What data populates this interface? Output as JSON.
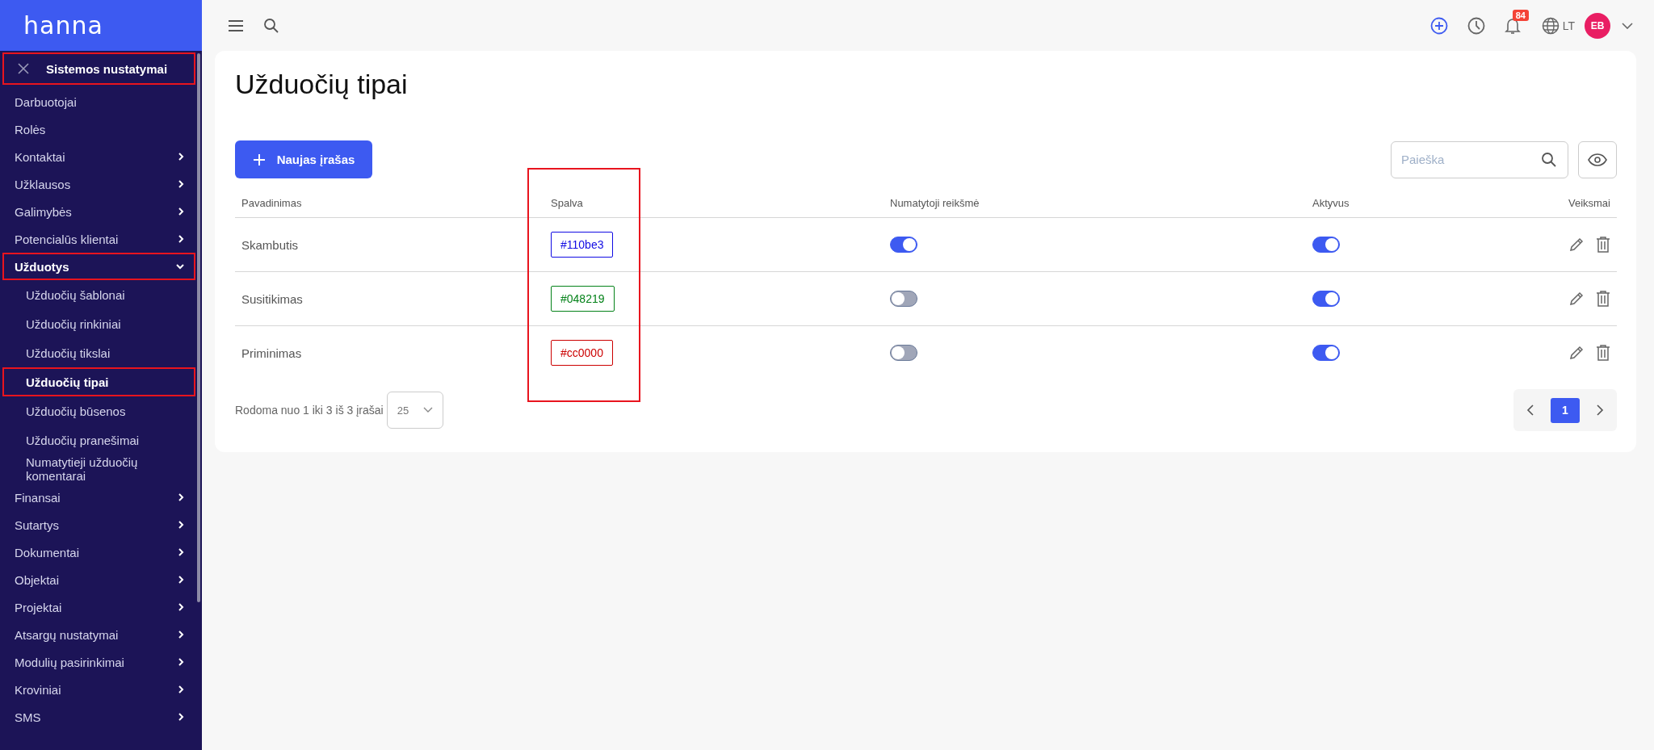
{
  "sidebar": {
    "logo": "hanna",
    "header": {
      "title": "Sistemos nustatymai",
      "highlighted": true
    },
    "items": [
      {
        "label": "Darbuotojai",
        "highlighted": false,
        "selected": false
      },
      {
        "label": "Rolės",
        "highlighted": false,
        "selected": false
      },
      {
        "label": "Kontaktai",
        "expanded": false,
        "highlighted": false,
        "selected": false
      },
      {
        "label": "Užklausos",
        "expanded": false,
        "highlighted": false,
        "selected": false
      },
      {
        "label": "Galimybės",
        "expanded": false,
        "highlighted": false,
        "selected": false
      },
      {
        "label": "Potencialūs klientai",
        "expanded": false,
        "highlighted": false,
        "selected": false
      },
      {
        "label": "Užduotys",
        "expanded": true,
        "highlighted": true,
        "selected": true,
        "children": [
          {
            "label": "Užduočių šablonai",
            "highlighted": false,
            "selected": false
          },
          {
            "label": "Užduočių rinkiniai",
            "highlighted": false,
            "selected": false
          },
          {
            "label": "Užduočių tikslai",
            "highlighted": false,
            "selected": false
          },
          {
            "label": "Užduočių tipai",
            "highlighted": true,
            "selected": true
          },
          {
            "label": "Užduočių būsenos",
            "highlighted": false,
            "selected": false
          },
          {
            "label": "Užduočių pranešimai",
            "highlighted": false,
            "selected": false
          },
          {
            "label": "Numatytieji užduočių komentarai",
            "highlighted": false,
            "selected": false
          }
        ]
      },
      {
        "label": "Finansai",
        "expanded": false,
        "highlighted": false,
        "selected": false
      },
      {
        "label": "Sutartys",
        "expanded": false,
        "highlighted": false,
        "selected": false
      },
      {
        "label": "Dokumentai",
        "expanded": false,
        "highlighted": false,
        "selected": false
      },
      {
        "label": "Objektai",
        "expanded": false,
        "highlighted": false,
        "selected": false
      },
      {
        "label": "Projektai",
        "expanded": false,
        "highlighted": false,
        "selected": false
      },
      {
        "label": "Atsargų nustatymai",
        "expanded": false,
        "highlighted": false,
        "selected": false
      },
      {
        "label": "Modulių pasirinkimai",
        "expanded": false,
        "highlighted": false,
        "selected": false
      },
      {
        "label": "Kroviniai",
        "expanded": false,
        "highlighted": false,
        "selected": false
      },
      {
        "label": "SMS",
        "expanded": false,
        "highlighted": false,
        "selected": false
      }
    ]
  },
  "topbar": {
    "notification_count": "84",
    "language": "LT",
    "avatar_initials": "EB"
  },
  "page": {
    "title": "Užduočių tipai",
    "new_button": "Naujas įrašas",
    "search": {
      "placeholder": "Paieška"
    }
  },
  "table": {
    "columns": [
      {
        "label": "Pavadinimas",
        "highlighted": false
      },
      {
        "label": "Spalva",
        "highlighted": true
      },
      {
        "label": "Numatytoji reikšmė",
        "highlighted": false
      },
      {
        "label": "Aktyvus",
        "highlighted": false
      },
      {
        "label": "Veiksmai",
        "highlighted": false
      }
    ],
    "rows": [
      {
        "name": "Skambutis",
        "color_label": "#110be3",
        "color": "#110be3",
        "default": true,
        "active": true
      },
      {
        "name": "Susitikimas",
        "color_label": "#048219",
        "color": "#048219",
        "default": false,
        "active": true
      },
      {
        "name": "Priminimas",
        "color_label": "#cc0000",
        "color": "#cc0000",
        "default": false,
        "active": true
      }
    ]
  },
  "footer": {
    "summary": "Rodoma nuo 1 iki 3 iš 3 įrašai",
    "page_size": "25",
    "pages": [
      {
        "label": "1",
        "selected": true
      }
    ]
  }
}
